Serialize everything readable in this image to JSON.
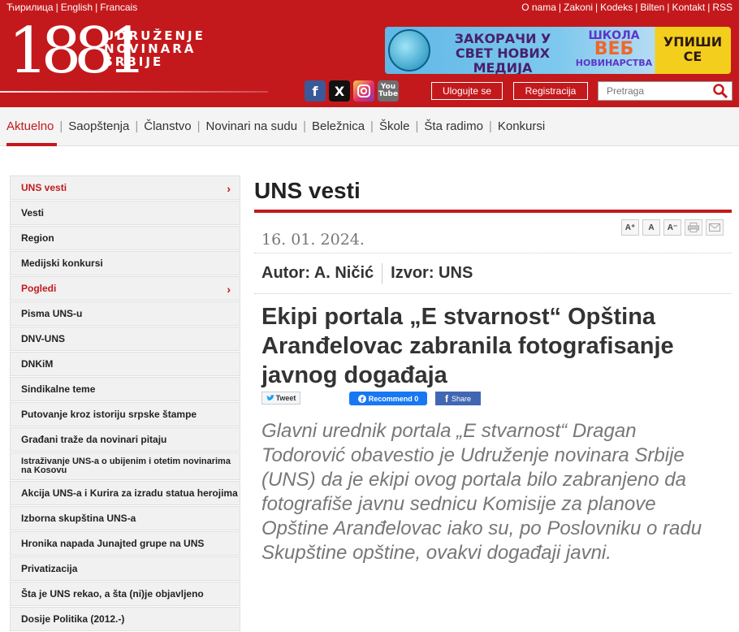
{
  "topbar": {
    "left_links": [
      "Ћирилица",
      "English",
      "Francais"
    ],
    "right_links": [
      "O nama",
      "Zakoni",
      "Kodeks",
      "Bilten",
      "Kontakt",
      "RSS"
    ]
  },
  "logo": {
    "number": "1881",
    "line1": "UDRUŽENJE",
    "line2": "NOVINARA",
    "line3": "SRBIJE"
  },
  "banner": {
    "text1": "ЗАКОРАЧИ У СВЕТ НОВИХ МЕДИЈА",
    "text2_a": "ШКОЛА",
    "text2_b": "ВЕБ",
    "text2_c": "НОВИНАРСТВА",
    "text3": "УПИШИ СЕ"
  },
  "social": {
    "yt_line1": "You",
    "yt_line2": "Tube"
  },
  "auth": {
    "login": "Ulogujte se",
    "register": "Registracija"
  },
  "search": {
    "placeholder": "Pretraga"
  },
  "nav": {
    "items": [
      "Aktuelno",
      "Saopštenja",
      "Članstvo",
      "Novinari na sudu",
      "Beležnica",
      "Škole",
      "Šta radimo",
      "Konkursi"
    ]
  },
  "sidebar": {
    "items": [
      "UNS vesti",
      "Vesti",
      "Region",
      "Medijski konkursi",
      "Pogledi",
      "Pisma UNS-u",
      "DNV-UNS",
      "DNKiM",
      "Sindikalne teme",
      "Putovanje kroz istoriju srpske štampe",
      "Građani traže da novinari pitaju",
      "Istraživanje UNS-a o ubijenim i otetim novinarima na Kosovu",
      "Akcija UNS-a i Kurira za izradu statua herojima",
      "Izborna skupština UNS-a",
      "Hronika napada Junajted grupe na UNS",
      "Privatizacija",
      "Šta je UNS rekao, a šta (ni)je objavljeno",
      "Dosije Politika (2012.-)"
    ]
  },
  "article": {
    "section": "UNS vesti",
    "date": "16. 01. 2024.",
    "author": "Autor: A. Ničić",
    "source": "Izvor: UNS",
    "headline": "Ekipi portala „E stvarnost“ Opština Aranđelovac zabranila fotografisanje javnog događaja",
    "lead": "Glavni urednik portala „E stvarnost“ Dragan Todorović obavestio je Udruženje novinara Srbije (UNS) da je ekipi ovog portala bilo zabranjeno da fotografiše javnu sednicu Komisije za planove Opštine Aranđelovac iako su, po Poslovniku o radu Skupštine opštine, ovakvi događaji javni."
  },
  "tools": {
    "increase": "A⁺",
    "normal": "A",
    "decrease": "A⁻"
  },
  "share": {
    "tweet": "Tweet",
    "recommend": "Recommend 0",
    "share": "Share"
  },
  "colors": {
    "brand_red": "#c4191c",
    "nav_bg": "#f4f4f4",
    "sidebar_bg": "#f1f1f1",
    "lead_gray": "#777777"
  }
}
